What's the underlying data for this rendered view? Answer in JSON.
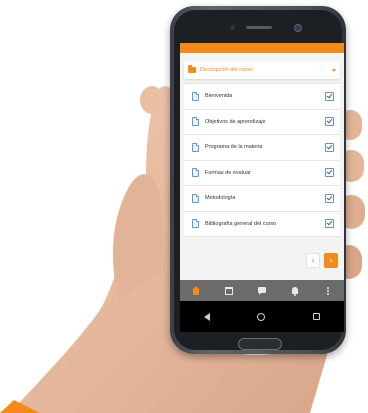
{
  "section": {
    "title": "Descripción del curso",
    "icon": "folder-icon",
    "expand_icon": "caret-down-icon"
  },
  "items": [
    {
      "label": "Bienvenida",
      "icon": "document-icon",
      "checked": true
    },
    {
      "label": "Objetivos de aprendizaje",
      "icon": "document-icon",
      "checked": true
    },
    {
      "label": "Programa de la materia",
      "icon": "document-icon",
      "checked": true
    },
    {
      "label": "Formas de evaluar",
      "icon": "document-icon",
      "checked": true
    },
    {
      "label": "Metodología",
      "icon": "document-icon",
      "checked": true
    },
    {
      "label": "Bibliografía general del curso",
      "icon": "document-icon",
      "checked": true
    }
  ],
  "pager": {
    "prev_symbol": "‹",
    "next_symbol": "›"
  },
  "bottom_nav": [
    "home-icon",
    "calendar-icon",
    "chat-icon",
    "bell-icon",
    "more-vertical-icon"
  ],
  "android_nav": [
    "back-icon",
    "home-circle-icon",
    "recents-icon"
  ],
  "colors": {
    "accent": "#f38b1c",
    "nav_bar": "#6b6b6b",
    "checkbox": "#2f5fa8",
    "doc_icon": "#5b9bd5"
  }
}
